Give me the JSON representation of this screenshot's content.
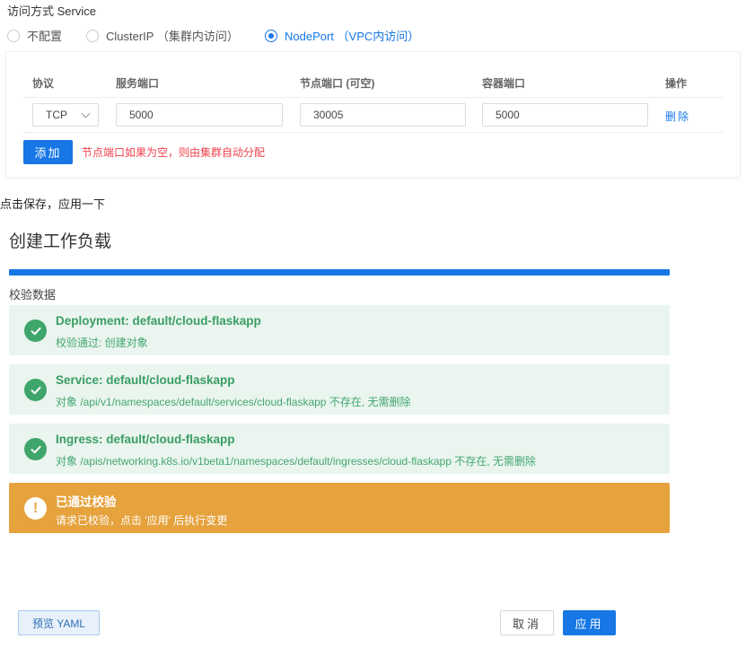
{
  "service": {
    "label": "访问方式 Service",
    "options": [
      {
        "label": "不配置",
        "checked": false
      },
      {
        "label": "ClusterIP （集群内访问）",
        "checked": false
      },
      {
        "label": "NodePort （VPC内访问）",
        "checked": true
      }
    ]
  },
  "ports": {
    "headers": {
      "protocol": "协议",
      "service_port": "服务端口",
      "node_port": "节点端口 (可空)",
      "container_port": "容器端口",
      "actions": "操作"
    },
    "row": {
      "protocol": "TCP",
      "service_port": "5000",
      "node_port": "30005",
      "container_port": "5000",
      "delete_label": "删除"
    },
    "add_label": "添加",
    "hint": "节点端口如果为空，则由集群自动分配"
  },
  "caption": "点击保存，应用一下",
  "dialog": {
    "title": "创建工作负载",
    "progress_percent": 100,
    "section_label": "校验数据",
    "results": [
      {
        "title": "Deployment: default/cloud-flaskapp",
        "detail": "校验通过: 创建对象",
        "status": "success"
      },
      {
        "title": "Service: default/cloud-flaskapp",
        "detail": "对象 /api/v1/namespaces/default/services/cloud-flaskapp 不存在, 无需删除",
        "status": "success"
      },
      {
        "title": "Ingress: default/cloud-flaskapp",
        "detail": "对象 /apis/networking.k8s.io/v1beta1/namespaces/default/ingresses/cloud-flaskapp 不存在, 无需删除",
        "status": "success"
      }
    ],
    "warning": {
      "title": "已通过校验",
      "detail": "请求已校验，点击 '应用' 后执行变更",
      "status": "warning"
    },
    "buttons": {
      "preview_yaml": "预览 YAML",
      "cancel": "取消",
      "apply": "应用"
    }
  },
  "colors": {
    "primary": "#1677e5",
    "success": "#3ea56b",
    "success_bg": "#e9f5ee",
    "warning": "#e6a23c",
    "danger_text": "#f0414c"
  },
  "icons": {
    "success": "check-circle-icon",
    "warning": "exclamation-circle-icon",
    "dropdown": "chevron-down-icon"
  }
}
